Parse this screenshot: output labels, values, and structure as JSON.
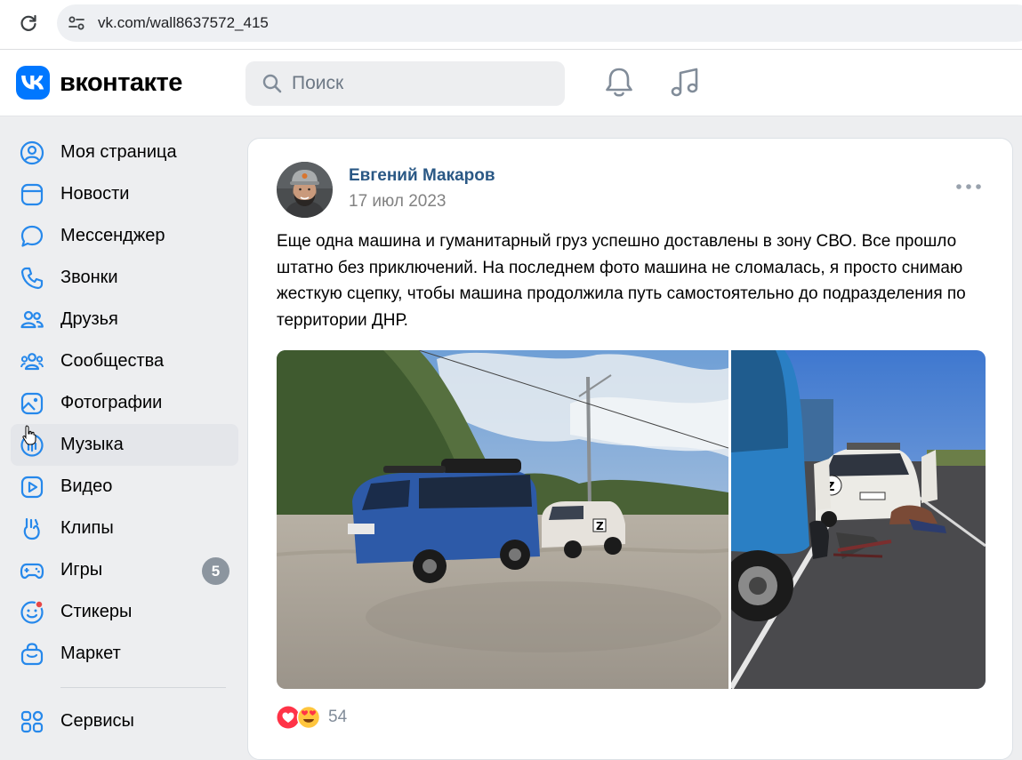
{
  "browser": {
    "url": "vk.com/wall8637572_415",
    "reload_icon": "reload-icon",
    "site_info_icon": "tune-icon"
  },
  "header": {
    "logo_text": "вконтакте",
    "search_placeholder": "Поиск",
    "notifications_icon": "bell-icon",
    "music_icon": "music-note-icon",
    "brand_color": "#0077ff"
  },
  "sidebar": {
    "items": [
      {
        "label": "Моя страница",
        "icon": "user-circle-icon"
      },
      {
        "label": "Новости",
        "icon": "news-icon"
      },
      {
        "label": "Мессенджер",
        "icon": "message-icon"
      },
      {
        "label": "Звонки",
        "icon": "phone-icon"
      },
      {
        "label": "Друзья",
        "icon": "friends-icon"
      },
      {
        "label": "Сообщества",
        "icon": "communities-icon"
      },
      {
        "label": "Фотографии",
        "icon": "photo-icon"
      },
      {
        "label": "Музыка",
        "icon": "music-icon",
        "hovered": true
      },
      {
        "label": "Видео",
        "icon": "video-icon"
      },
      {
        "label": "Клипы",
        "icon": "clips-icon"
      },
      {
        "label": "Игры",
        "icon": "gamepad-icon",
        "badge": "5"
      },
      {
        "label": "Стикеры",
        "icon": "sticker-icon"
      },
      {
        "label": "Маркет",
        "icon": "market-bag-icon"
      }
    ],
    "services": {
      "label": "Сервисы",
      "icon": "services-grid-icon"
    }
  },
  "post": {
    "author": "Евгений Макаров",
    "date": "17 июл 2023",
    "text": "Еще одна машина и гуманитарный груз успешно доставлены в зону СВО. Все прошло штатно без приключений. На последнем фото машина не сломалась, я просто снимаю жесткую сцепку, чтобы машина продолжила путь самостоятельно до подразделения по территории ДНР.",
    "more_icon": "more-horizontal-icon",
    "photos": [
      "photo-van-and-niva",
      "photo-towing-hitch"
    ],
    "reactions": {
      "icons": [
        "heart-reaction-icon",
        "heart-eyes-reaction-icon"
      ],
      "count": "54"
    },
    "author_color": "#2a5885"
  }
}
